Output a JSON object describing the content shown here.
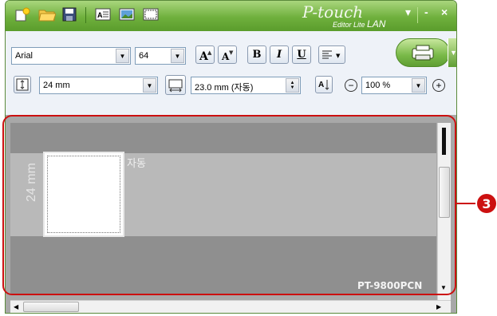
{
  "window": {
    "brand_main": "P-touch",
    "brand_sub": "Editor Lite",
    "brand_lan": "LAN",
    "minimize_label": "-",
    "close_label": "×",
    "options_label": "▾"
  },
  "toolbar": {
    "font_name": "Arial",
    "font_size": "64",
    "bold_label": "B",
    "italic_label": "I",
    "underline_label": "U",
    "tape_width": "24 mm",
    "label_length": "23.0 mm (자동)",
    "zoom": "100 %",
    "zoom_out_label": "−",
    "zoom_in_label": "+"
  },
  "editor": {
    "label_text": "자동",
    "tape_size_text": "24 mm",
    "printer_model": "PT-9800PCN"
  },
  "callout": {
    "number": "3"
  },
  "colors": {
    "titlebar_green": "#6fb03d",
    "callout_red": "#cc1010",
    "editor_gray": "#a8a8a8"
  }
}
